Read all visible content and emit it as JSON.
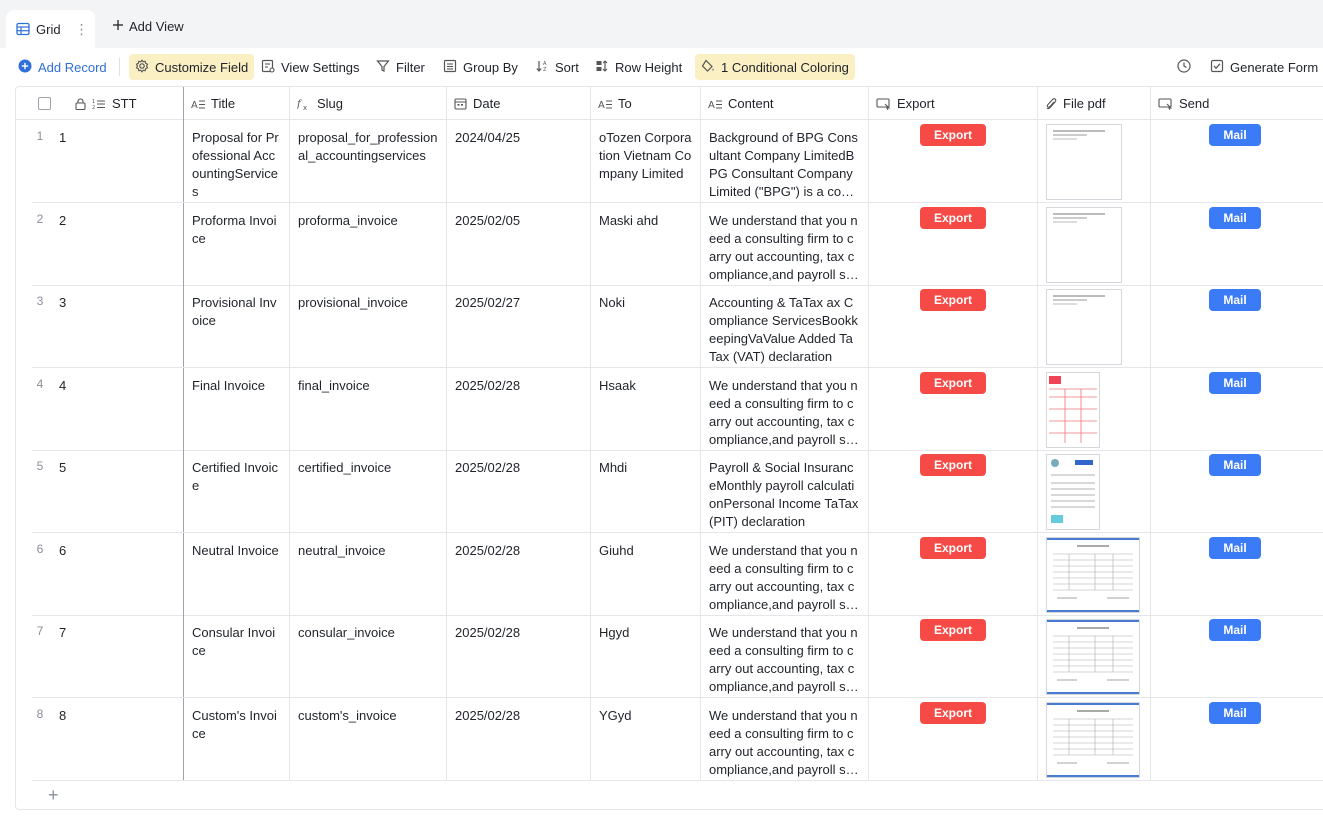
{
  "tabs": {
    "active_label": "Grid",
    "add_view_label": "Add View"
  },
  "toolbar": {
    "add_record": "Add Record",
    "customize_field": "Customize Field",
    "view_settings": "View Settings",
    "filter": "Filter",
    "group_by": "Group By",
    "sort": "Sort",
    "row_height": "Row Height",
    "conditional_coloring": "1 Conditional Coloring",
    "generate_form": "Generate Form"
  },
  "columns": {
    "stt": "STT",
    "title": "Title",
    "slug": "Slug",
    "date": "Date",
    "to": "To",
    "content": "Content",
    "export": "Export",
    "file_pdf": "File pdf",
    "send": "Send"
  },
  "buttons": {
    "export": "Export",
    "mail": "Mail"
  },
  "rows": [
    {
      "num": "1",
      "stt": "1",
      "title": "Proposal for Professional AccountingServices",
      "slug": "proposal_for_professional_accountingservices",
      "date": "2024/04/25",
      "to": "oTozen Corporation Vietnam Company Limited",
      "content": "Background of BPG Consultant Company LimitedBPG Consultant Company Limited (\"BPG\") is a consulting firm",
      "thumb": "doc"
    },
    {
      "num": "2",
      "stt": "2",
      "title": "Proforma Invoice",
      "slug": "proforma_invoice",
      "date": "2025/02/05",
      "to": "Maski ahd",
      "content": "We understand that you need a consulting firm to carry out accounting, tax compliance,and payroll services",
      "thumb": "doc"
    },
    {
      "num": "3",
      "stt": "3",
      "title": "Provisional Invoice",
      "slug": "provisional_invoice",
      "date": "2025/02/27",
      "to": "Noki",
      "content": "Accounting & TaTax ax Compliance ServicesBookkeepingVaValue Added TaTax (VAT) declaration",
      "thumb": "doc"
    },
    {
      "num": "4",
      "stt": "4",
      "title": "Final Invoice",
      "slug": "final_invoice",
      "date": "2025/02/28",
      "to": "Hsaak",
      "content": "We understand that you need a consulting firm to carry out accounting, tax compliance,and payroll services",
      "thumb": "red"
    },
    {
      "num": "5",
      "stt": "5",
      "title": "Certified Invoice",
      "slug": "certified_invoice",
      "date": "2025/02/28",
      "to": "Mhdi",
      "content": "Payroll & Social InsuranceMonthly payroll calculationPersonal Income TaTax (PIT) declaration",
      "thumb": "invoice"
    },
    {
      "num": "6",
      "stt": "6",
      "title": "Neutral Invoice",
      "slug": "neutral_invoice",
      "date": "2025/02/28",
      "to": "Giuhd",
      "content": "We understand that you need a consulting firm to carry out accounting, tax compliance,and payroll services",
      "thumb": "table"
    },
    {
      "num": "7",
      "stt": "7",
      "title": "Consular Invoice",
      "slug": "consular_invoice",
      "date": "2025/02/28",
      "to": "Hgyd",
      "content": "We understand that you need a consulting firm to carry out accounting, tax compliance,and payroll services",
      "thumb": "table"
    },
    {
      "num": "8",
      "stt": "8",
      "title": "Custom's Invoice",
      "slug": "custom's_invoice",
      "date": "2025/02/28",
      "to": "YGyd",
      "content": "We understand that you need a consulting firm to carry out accounting, tax compliance,and payroll services",
      "thumb": "table"
    }
  ],
  "colors": {
    "export_button": "#f54a45",
    "mail_button": "#3c7bf6",
    "highlight": "#fbefc4",
    "accent": "#2f6fd8"
  }
}
